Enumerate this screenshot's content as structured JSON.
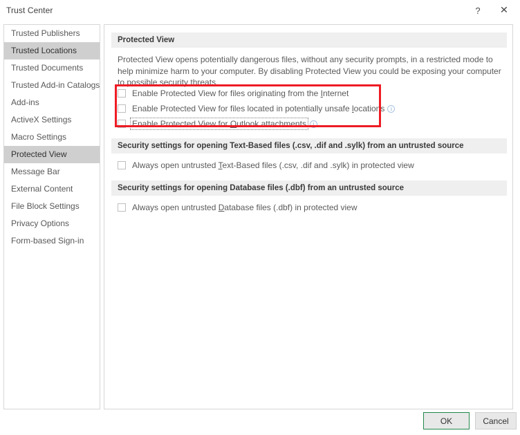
{
  "window": {
    "title": "Trust Center",
    "help_icon": "question-mark-icon",
    "help_glyph": "?",
    "close_icon": "close-x-icon",
    "close_glyph": "✕"
  },
  "sidebar": {
    "items": [
      {
        "label": "Trusted Publishers",
        "selected": false
      },
      {
        "label": "Trusted Locations",
        "selected": true
      },
      {
        "label": "Trusted Documents",
        "selected": false
      },
      {
        "label": "Trusted Add-in Catalogs",
        "selected": false
      },
      {
        "label": "Add-ins",
        "selected": false
      },
      {
        "label": "ActiveX Settings",
        "selected": false
      },
      {
        "label": "Macro Settings",
        "selected": false
      },
      {
        "label": "Protected View",
        "selected": true
      },
      {
        "label": "Message Bar",
        "selected": false
      },
      {
        "label": "External Content",
        "selected": false
      },
      {
        "label": "File Block Settings",
        "selected": false
      },
      {
        "label": "Privacy Options",
        "selected": false
      },
      {
        "label": "Form-based Sign-in",
        "selected": false
      }
    ]
  },
  "main": {
    "section1": {
      "header": "Protected View",
      "description": "Protected View opens potentially dangerous files, without any security prompts, in a restricted mode to help minimize harm to your computer. By disabling Protected View you could be exposing your computer to possible security threats.",
      "checkboxes": [
        {
          "pre": "Enable Protected View for files originating from the ",
          "accel": "I",
          "post": "nternet",
          "checked": false,
          "info": false,
          "focused": false
        },
        {
          "pre": "Enable Protected View for files located in potentially unsafe ",
          "accel": "l",
          "post": "ocations",
          "checked": false,
          "info": true,
          "focused": false
        },
        {
          "pre": "Enable Protected View for ",
          "accel": "O",
          "post": "utlook attachments",
          "checked": false,
          "info": true,
          "focused": true
        }
      ]
    },
    "section2": {
      "header": "Security settings for opening Text-Based files (.csv, .dif and .sylk) from an untrusted source",
      "checkboxes": [
        {
          "pre": "Always open untrusted ",
          "accel": "T",
          "post": "ext-Based files (.csv, .dif and .sylk) in protected view",
          "checked": false,
          "info": false,
          "focused": false
        }
      ]
    },
    "section3": {
      "header": "Security settings for opening Database files (.dbf) from an untrusted source",
      "checkboxes": [
        {
          "pre": "Always open untrusted ",
          "accel": "D",
          "post": "atabase files (.dbf) in protected view",
          "checked": false,
          "info": false,
          "focused": false
        }
      ]
    }
  },
  "annotation": {
    "highlight_color": "#ee1b24",
    "name": "red-highlight-box"
  },
  "footer": {
    "ok_label": "OK",
    "cancel_label": "Cancel"
  },
  "colors": {
    "selected_sidebar": "#cfcfcf",
    "section_header_bg": "#efefef",
    "ok_accent": "#21874b",
    "info_icon": "#7fa6cc"
  }
}
